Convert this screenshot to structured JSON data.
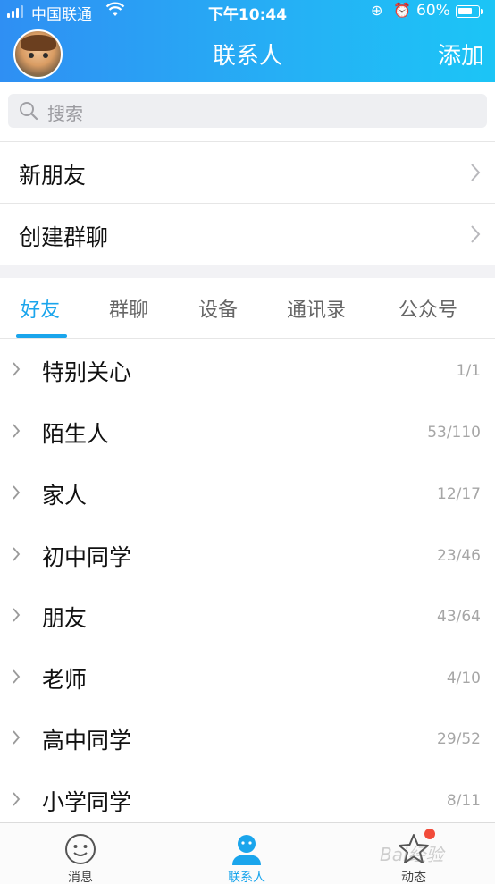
{
  "status_bar": {
    "carrier": "中国联通",
    "time": "下午10:44",
    "battery_percent": "60%",
    "battery_level": 0.6
  },
  "header": {
    "title": "联系人",
    "add_label": "添加"
  },
  "search": {
    "placeholder": "搜索"
  },
  "actions": [
    {
      "label": "新朋友"
    },
    {
      "label": "创建群聊"
    }
  ],
  "tabs": [
    {
      "label": "好友",
      "active": true
    },
    {
      "label": "群聊"
    },
    {
      "label": "设备"
    },
    {
      "label": "通讯录"
    },
    {
      "label": "公众号"
    }
  ],
  "groups": [
    {
      "name": "特别关心",
      "count": "1/1"
    },
    {
      "name": "陌生人",
      "count": "53/110"
    },
    {
      "name": "家人",
      "count": "12/17"
    },
    {
      "name": "初中同学",
      "count": "23/46"
    },
    {
      "name": "朋友",
      "count": "43/64"
    },
    {
      "name": "老师",
      "count": "4/10"
    },
    {
      "name": "高中同学",
      "count": "29/52"
    },
    {
      "name": "小学同学",
      "count": "8/11"
    }
  ],
  "tabbar": [
    {
      "label": "消息",
      "icon": "smiley-icon"
    },
    {
      "label": "联系人",
      "icon": "person-icon",
      "active": true
    },
    {
      "label": "动态",
      "icon": "star-icon",
      "badge": true
    }
  ],
  "watermark": "Bai经验",
  "colors": {
    "accent": "#1aa5ec",
    "header_start": "#2f8ff3",
    "header_end": "#1cc5f6",
    "badge": "#f24b3a"
  }
}
